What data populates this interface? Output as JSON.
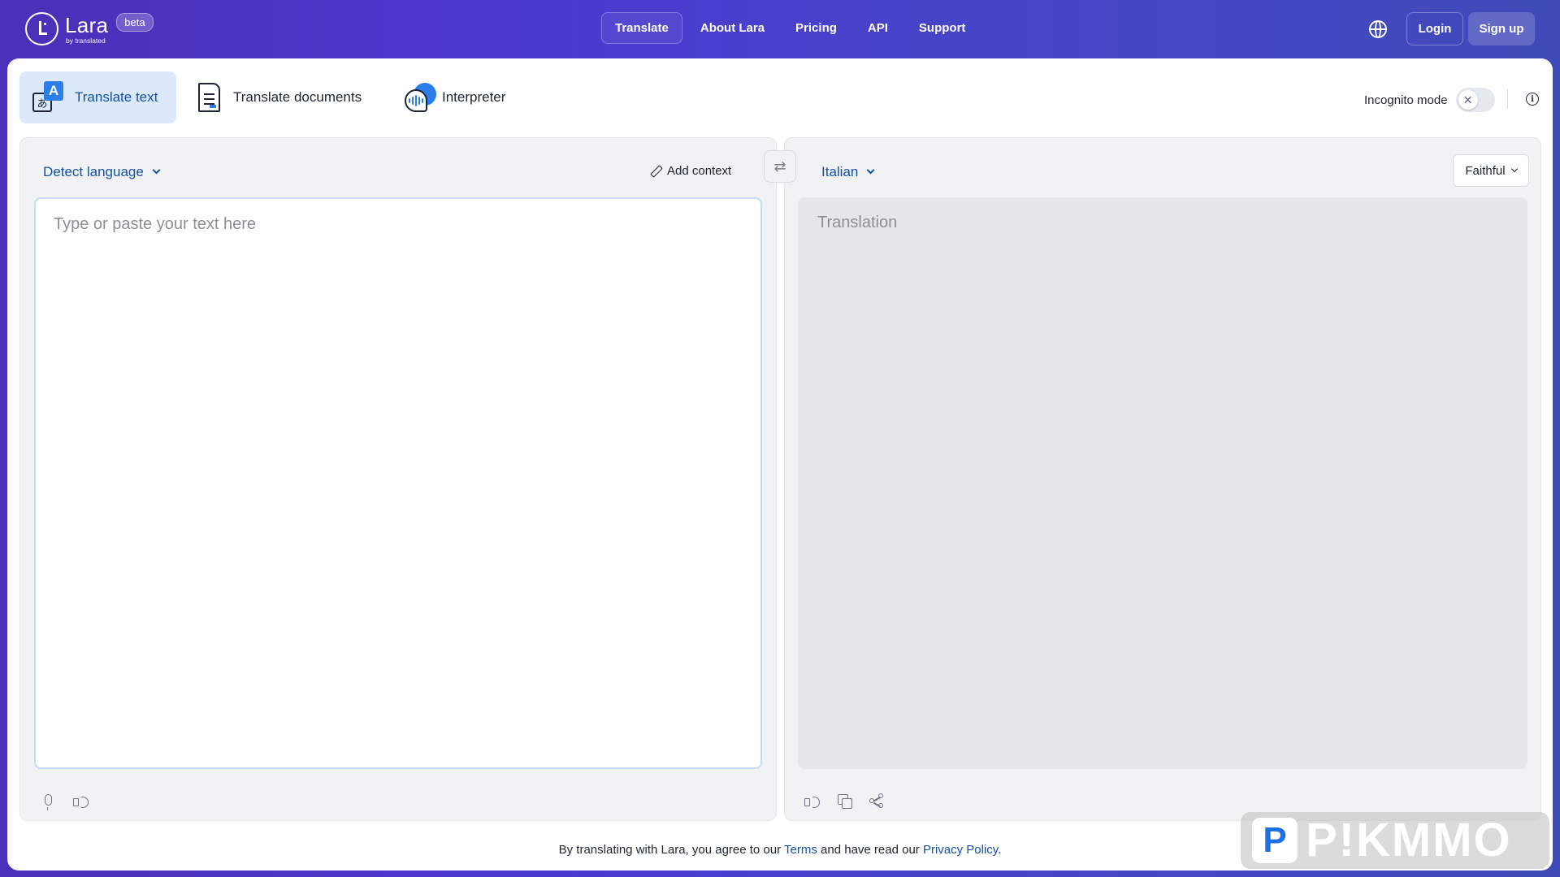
{
  "header": {
    "logo_name": "Lara",
    "logo_by": "by translated",
    "beta": "beta",
    "nav": [
      "Translate",
      "About Lara",
      "Pricing",
      "API",
      "Support"
    ],
    "login": "Login",
    "signup": "Sign up"
  },
  "modes": {
    "tabs": [
      "Translate text",
      "Translate documents",
      "Interpreter"
    ],
    "active": "Translate text",
    "icon_glyphs": {
      "latin": "A",
      "kana": "あ"
    }
  },
  "incognito": {
    "label": "Incognito mode",
    "enabled": false,
    "toggle_glyph": "✕"
  },
  "source": {
    "language": "Detect language",
    "add_context": "Add context",
    "placeholder": "Type or paste your text here"
  },
  "target": {
    "language": "Italian",
    "style": "Faithful",
    "placeholder": "Translation"
  },
  "swap_glyph": "⇄",
  "footer": {
    "pre": "By translating with Lara, you agree to our ",
    "terms": "Terms",
    "mid": " and have read our ",
    "privacy": "Privacy Policy",
    "post": "."
  },
  "watermark": {
    "badge": "P",
    "text": "P!KMMO"
  },
  "colors": {
    "accent": "#1351a5",
    "active_tab_bg": "#dbe9fb",
    "header_gradient_start": "#4b2fb8",
    "header_gradient_end": "#3f4ab8"
  },
  "icons": [
    "globe-icon",
    "translate-text-icon",
    "document-icon",
    "interpreter-icon",
    "info-icon",
    "pencil-icon",
    "swap-icon",
    "microphone-icon",
    "speaker-icon",
    "copy-icon",
    "share-icon"
  ]
}
